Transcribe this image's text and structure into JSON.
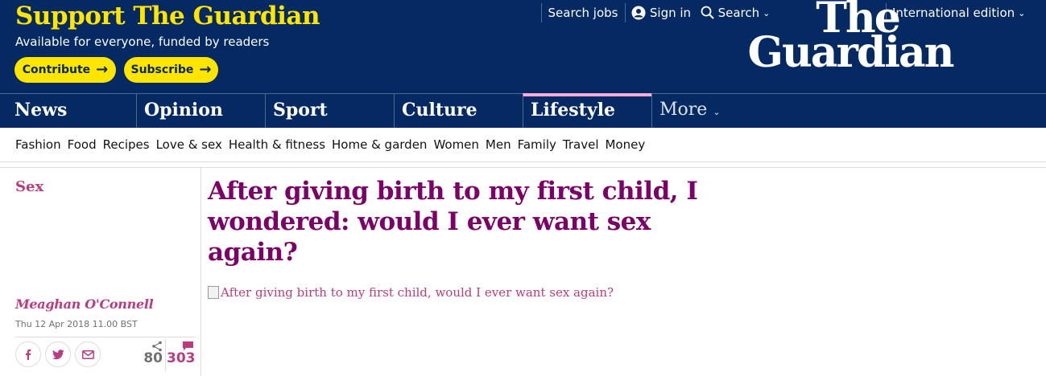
{
  "support": {
    "title": "Support The Guardian",
    "subtitle": "Available for everyone, funded by readers",
    "contribute_label": "Contribute",
    "subscribe_label": "Subscribe",
    "arrow": "→"
  },
  "top_links": {
    "search_jobs": "Search jobs",
    "sign_in": "Sign in",
    "search": "Search",
    "edition": "International edition"
  },
  "logo": {
    "line1": "The",
    "line2": "Guardian"
  },
  "pillars": [
    {
      "label": "News"
    },
    {
      "label": "Opinion"
    },
    {
      "label": "Sport"
    },
    {
      "label": "Culture"
    },
    {
      "label": "Lifestyle"
    },
    {
      "label": "More"
    }
  ],
  "subnav": [
    "Fashion",
    "Food",
    "Recipes",
    "Love & sex",
    "Health & fitness",
    "Home & garden",
    "Women",
    "Men",
    "Family",
    "Travel",
    "Money"
  ],
  "article": {
    "section": "Sex",
    "headline": "After giving birth to my first child, I wondered: would I ever want sex again?",
    "byline": "Meaghan O'Connell",
    "date": "Thu 12 Apr 2018 11.00 BST",
    "image_alt": "After giving birth to my first child, would I ever want sex again?",
    "share_count": "80",
    "comment_count": "303"
  },
  "colors": {
    "brand": "#052962",
    "highlight": "#ffe500",
    "lifestyle": "#7d0068",
    "lifestyle_light": "#bb3b80",
    "lifestyle_pillar": "#ffabdb"
  },
  "icons": {
    "facebook": "facebook-icon",
    "twitter": "twitter-icon",
    "email": "email-icon",
    "share": "share-icon",
    "comment": "comment-icon",
    "user": "user-icon",
    "search": "search-icon"
  }
}
